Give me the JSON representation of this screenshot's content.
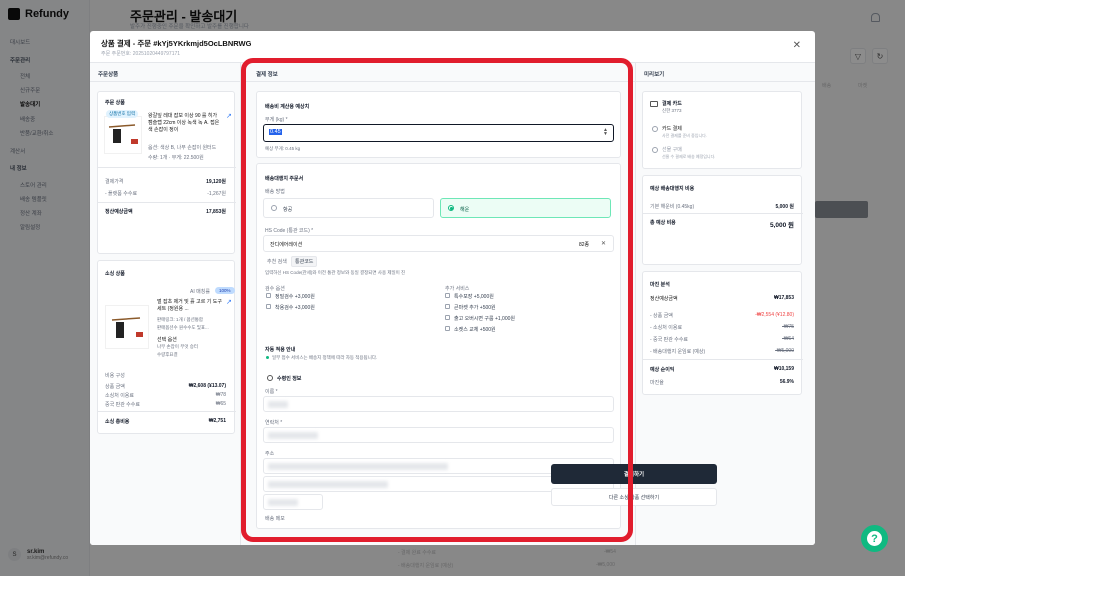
{
  "app": {
    "logo": "Refundy",
    "page_title": "주문관리 - 발송대기",
    "page_subtitle": "발주가 진행중인 주문을 확인하고 발주를 진행합니다",
    "sidebar": {
      "items": [
        "대시보드",
        "주문관리",
        "전체",
        "신규주문",
        "발송대기",
        "배송중",
        "반품/교환/취소",
        "계산서",
        "내 정보",
        "스토어 관리",
        "배송 템플릿",
        "정산 계좌",
        "알림설정"
      ]
    },
    "user": {
      "initial": "S",
      "name": "sr.kim",
      "email": "sr.kim@refundy.co"
    },
    "background_texts": {
      "col1": "배송",
      "col2": "마켓",
      "col3": "관리",
      "b1": "- 결제 완료 수수료",
      "b1v": "-₩54",
      "b2": "- 배송대행지 운임료 (예상)",
      "b2v": "-₩5,000"
    }
  },
  "modal": {
    "title": "상품 결제 - 주문 #kYj5YKrkmjd5OcLBNRWG",
    "order_date": "주문 주문번호: 20251020449797171",
    "close_icon": "✕",
    "left": {
      "header": "주문상품",
      "order_card": {
        "title": "주문 상품",
        "badge": "상품번호 입력",
        "product_name": "왕갈잎 레대 잡보 이상 90 를 히가 캠슬랩 22cm 이상 녹색 녹 A. 접은색 손잡이 정이",
        "option": "옵션: 색상 B, 나무 손잡이 원터드",
        "qty": "수량: 1개 · 무게: 22.500원",
        "price_label": "결제가격",
        "price": "19,120원",
        "fee_label": "- 플랫폼 수수료",
        "fee": "-1,267원",
        "settle_label": "정산예상금액",
        "settle": "17,853원"
      },
      "source_card": {
        "title": "소싱 상품",
        "ai_label": "AI 매칭률",
        "ai_value": "100%",
        "product_name": "벌 잡초 제거 및 흙 고르 기 도구 세트 (정원용 ...",
        "meta1": "판매링크: 1개 / 옵션통합",
        "meta2": "판매옵션수 원수수도 및표...",
        "option_label": "선택 옵션",
        "option_value": "나무 손잡이 무엇 승터",
        "option_sub": "수량후묘결",
        "cost_label": "비용 구성",
        "c1": "상품 금액",
        "c1v": "₩2,608 (¥13.07)",
        "c2": "소싱처 이용료",
        "c2v": "₩78",
        "c3": "중국 판관 수수료",
        "c3v": "₩65",
        "total_label": "소싱 총비용",
        "total": "₩2,751"
      }
    },
    "center": {
      "header": "결제 정보",
      "shipping_calc": {
        "title": "배송비 계산용 예상치",
        "weight_label": "무게 (kg) *",
        "weight_value": "0.45",
        "weight_hint": "예상 무게: 0.45 kg"
      },
      "forwarder": {
        "title": "배송대행지 주문서",
        "method_label": "배송 방법",
        "opt1": "항공",
        "opt2": "해운",
        "hs_label": "HS Code (통관 코드) *",
        "hs_value": "잔디에어레이션",
        "hs_count": "82종",
        "tab1": "추천 검색",
        "tab2": "통관코드",
        "hs_hint": "입력하신 HS Code(관세)와 이전 통관 정보와 동일 결정되면 사용 제일이 진",
        "inspect_title": "검수 옵션",
        "inspect1": "정밀검수 +3,000원",
        "inspect2": "착용검수 +3,000원",
        "extra_title": "추가 서비스",
        "extra1": "특수포장 +5,000원",
        "extra2": "큰마켓 추가 +500원",
        "extra3": "출고 오버시면 구룹 +1,000원",
        "extra4": "소켓스 교체 +500원",
        "auto_title": "자동 적용 안내",
        "auto_text": "일부 접수 서비스는 배송지 정책에 따라 자동 적용됩니다."
      },
      "receiver": {
        "title": "수령인 정보",
        "name_label": "이름 *",
        "phone_label": "연락처 *",
        "address_label": "주소",
        "memo_label": "배송 메모"
      }
    },
    "right": {
      "header": "미리보기",
      "payment": {
        "title": "결제 카드",
        "sub": "신한 3773",
        "opt1": "카드 결제",
        "opt1_sub": "사전 결제를 준비 중입니다.",
        "opt2": "선물 구매",
        "opt2_sub": "선물 수 결제로 배송 예정입니다."
      },
      "forwarder_cost": {
        "title": "예상 배송대행지 비용",
        "row1": "기본 해운비 (0.45kg)",
        "row1v": "5,000 원",
        "total_label": "총 예상 비용",
        "total": "5,000 원"
      },
      "margin": {
        "title": "마진 분석",
        "r1": "정산예상금액",
        "r1v": "₩17,853",
        "r2": "- 상품 금액",
        "r2v": "-₩2,554 (¥12.80)",
        "r3": "- 소싱처 이용료",
        "r3v": "-₩75",
        "r4": "- 중국 판관 수수료",
        "r4v": "-₩64",
        "r5": "- 배송대행지 운임료 (예상)",
        "r5v": "-₩5,000",
        "r6": "예상 순이익",
        "r6v": "₩10,159",
        "r7": "마진율",
        "r7v": "56.9%"
      },
      "pay_button": "결제하기",
      "alt_button": "다른 소싱 상품 선택하기"
    }
  },
  "colors": {
    "highlight": "#e11d2d",
    "accent": "#10b981",
    "dark": "#1f2937"
  }
}
